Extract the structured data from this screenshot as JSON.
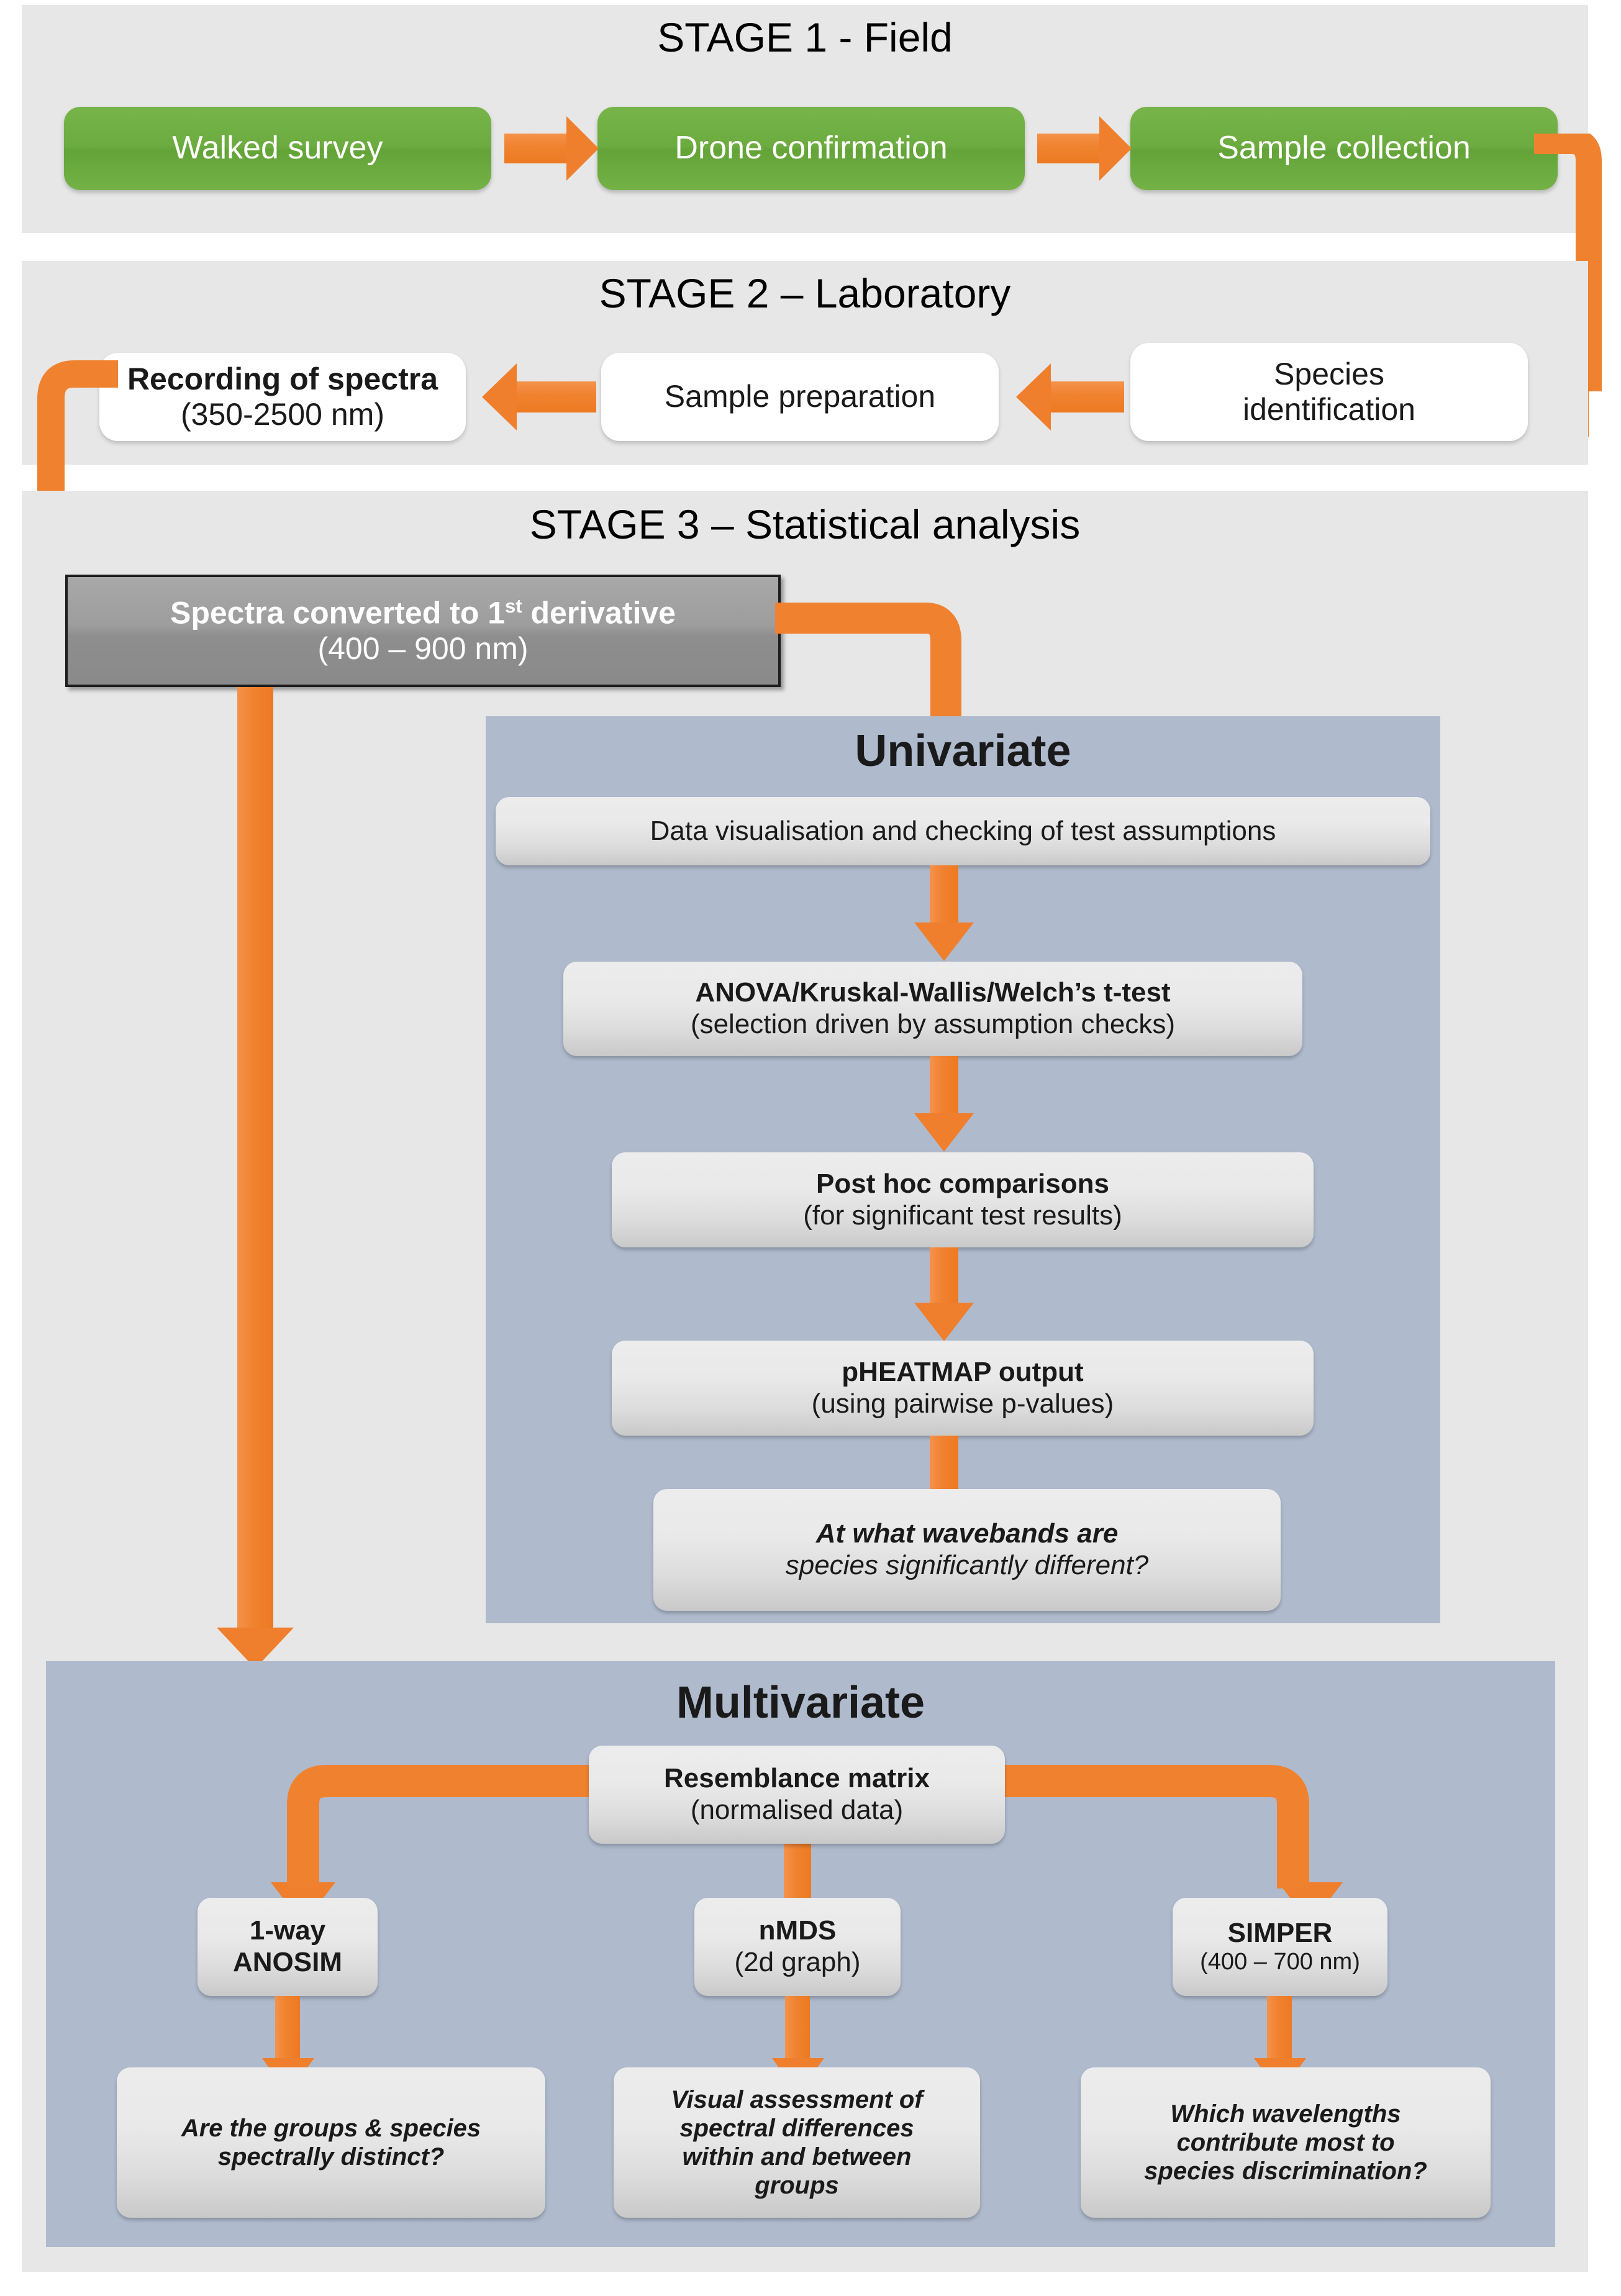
{
  "figure": {
    "type": "flowchart",
    "title": "Three-stage workflow for spectral species discrimination"
  },
  "stages": [
    {
      "id": "stage1",
      "title": "STAGE 1 - Field",
      "nodes": [
        {
          "id": "walked-survey",
          "line1": "Walked survey",
          "line2": ""
        },
        {
          "id": "drone-confirmation",
          "line1": "Drone confirmation",
          "line2": ""
        },
        {
          "id": "sample-collection",
          "line1": "Sample collection",
          "line2": ""
        }
      ]
    },
    {
      "id": "stage2",
      "title": "STAGE 2 – Laboratory",
      "nodes": [
        {
          "id": "recording-of-spectra",
          "line1": "Recording of spectra",
          "line2": "(350-2500 nm)"
        },
        {
          "id": "sample-preparation",
          "line1": "Sample preparation",
          "line2": ""
        },
        {
          "id": "species-identification",
          "line1": "Species",
          "line2": "identification"
        }
      ]
    },
    {
      "id": "stage3",
      "title": "STAGE 3 – Statistical analysis",
      "derivative": {
        "id": "spectra-converted",
        "line1_a": "Spectra converted to 1",
        "line1_sup": "st",
        "line1_b": " derivative",
        "line2": "(400 – 900 nm)"
      },
      "univariate": {
        "title": "Univariate",
        "nodes": [
          {
            "id": "data-visualisation",
            "line1": "Data visualisation and checking of test assumptions",
            "line2": ""
          },
          {
            "id": "anova-kruskal-welch",
            "line1": "ANOVA/Kruskal-Wallis/Welch’s t-test",
            "line2": "(selection driven by assumption checks)"
          },
          {
            "id": "post-hoc-comparisons",
            "line1": "Post hoc comparisons",
            "line2": "(for significant test results)"
          },
          {
            "id": "pheatmap-output",
            "line1": "pHEATMAP output",
            "line2": "(using pairwise p-values)"
          },
          {
            "id": "univariate-question",
            "line1": "At what wavebands are",
            "line2": "species significantly different?"
          }
        ]
      },
      "multivariate": {
        "title": "Multivariate",
        "resemblance": {
          "id": "resemblance-matrix",
          "line1": "Resemblance matrix",
          "line2": "(normalised data)"
        },
        "branches": [
          {
            "method": {
              "id": "anosim",
              "line1": "1-way",
              "line2": "ANOSIM"
            },
            "question": {
              "id": "anosim-question",
              "line1": "Are the groups & species",
              "line2": "spectrally distinct?",
              "line3": "",
              "line4": ""
            }
          },
          {
            "method": {
              "id": "nmds",
              "line1": "nMDS",
              "line2": "(2d graph)"
            },
            "question": {
              "id": "nmds-question",
              "line1": "Visual assessment of",
              "line2": "spectral differences",
              "line3": "within and between",
              "line4": "groups"
            }
          },
          {
            "method": {
              "id": "simper",
              "line1": "SIMPER",
              "line2": "(400 – 700 nm)"
            },
            "question": {
              "id": "simper-question",
              "line1": "Which wavelengths",
              "line2": "contribute most to",
              "line3": "species discrimination?",
              "line4": ""
            }
          }
        ]
      }
    }
  ],
  "colors": {
    "panel_background": "#e7e7e7",
    "subpanel_background": "#afbacd",
    "arrow": "#ef7f2c",
    "green_node": "#6cab3f",
    "gray_node": "#9d9d9d",
    "silver_node": "#e4e4e4",
    "white_node": "#ffffff",
    "text_dark": "#1a1a1a",
    "text_light": "#ffffff"
  }
}
